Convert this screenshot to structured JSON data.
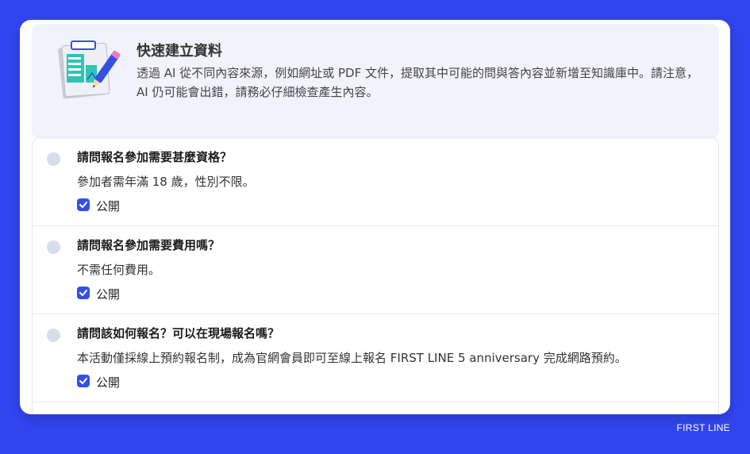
{
  "banner": {
    "title": "快速建立資料",
    "description": "透過 AI 從不同內容來源，例如網址或 PDF 文件，提取其中可能的問與答內容並新增至知識庫中。請注意，AI 仍可能會出錯，請務必仔細檢查產生內容。",
    "illustration_icon": "clipboard-pencil-icon"
  },
  "qa_items": [
    {
      "question": "請問報名參加需要甚麼資格？",
      "answer": "參加者需年滿 18 歲，性別不限。",
      "public_label": "公開",
      "public_checked": true
    },
    {
      "question": "請問報名參加需要費用嗎？",
      "answer": "不需任何費用。",
      "public_label": "公開",
      "public_checked": true
    },
    {
      "question": "請問該如何報名？可以在現場報名嗎？",
      "answer": "本活動僅採線上預約報名制，成為官網會員即可至線上報名 FIRST LINE 5 anniversary 完成網路預約。",
      "public_label": "公開",
      "public_checked": true
    }
  ],
  "brand": "FIRST LINE",
  "colors": {
    "background": "#3146f1",
    "checkbox": "#3550e0",
    "banner_bg": "#f1f2fb",
    "radio": "#d6deea"
  }
}
